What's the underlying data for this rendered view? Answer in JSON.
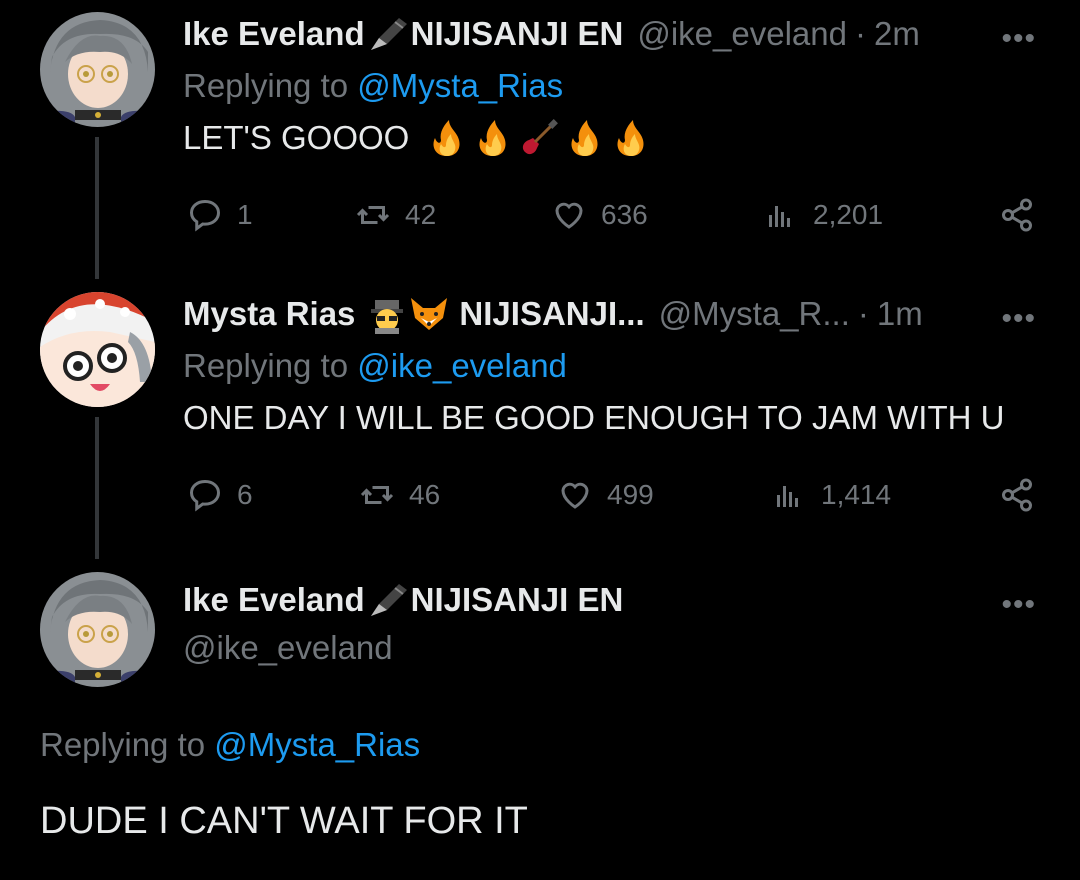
{
  "tweets": [
    {
      "display_name": "Ike Eveland",
      "name_suffix": "NIJISANJI EN",
      "handle": "@ike_eveland",
      "time": "2m",
      "replying_prefix": "Replying to",
      "replying_to": "@Mysta_Rias",
      "text": "LET'S GOOOO",
      "replies": "1",
      "retweets": "42",
      "likes": "636",
      "views": "2,201"
    },
    {
      "display_name": "Mysta Rias",
      "name_suffix": "NIJISANJI...",
      "handle": "@Mysta_R...",
      "time": "1m",
      "replying_prefix": "Replying to",
      "replying_to": "@ike_eveland",
      "text": "ONE DAY I WILL BE GOOD ENOUGH TO JAM WITH U",
      "replies": "6",
      "retweets": "46",
      "likes": "499",
      "views": "1,414"
    },
    {
      "display_name": "Ike Eveland",
      "name_suffix": "NIJISANJI EN",
      "handle": "@ike_eveland",
      "replying_prefix": "Replying to",
      "replying_to": "@Mysta_Rias",
      "text": "DUDE I CAN'T WAIT FOR IT"
    }
  ],
  "colors": {
    "background": "#000000",
    "text": "#e7e9ea",
    "muted": "#71767b",
    "accent": "#1d9bf0"
  },
  "icons": [
    "more-icon",
    "reply-icon",
    "retweet-icon",
    "like-icon",
    "views-icon",
    "share-icon",
    "fountain-pen-icon",
    "fire-emoji",
    "guitar-emoji",
    "detective-emoji",
    "fox-emoji"
  ]
}
